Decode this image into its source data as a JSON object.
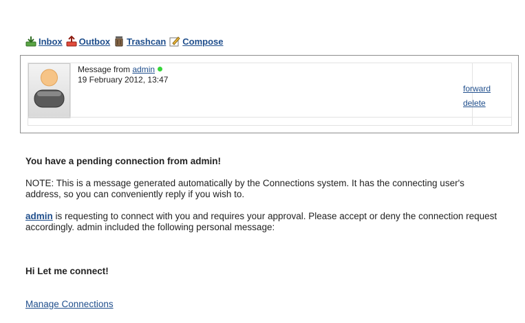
{
  "nav": {
    "items": [
      {
        "label": "Inbox",
        "icon": "inbox-icon"
      },
      {
        "label": "Outbox",
        "icon": "outbox-icon"
      },
      {
        "label": "Trashcan",
        "icon": "trashcan-icon"
      },
      {
        "label": "Compose",
        "icon": "compose-icon"
      }
    ]
  },
  "message": {
    "from_prefix": "Message from",
    "sender": "admin",
    "date": "19 February 2012, 13:47",
    "online_color": "#36d63a",
    "actions": {
      "forward": "forward",
      "delete": "delete"
    }
  },
  "body": {
    "heading": "You have a pending connection from admin!",
    "note": "NOTE: This is a message generated automatically by the Connections system. It has the connecting user's address, so you can conveniently reply if you wish to.",
    "request_link": "admin",
    "request_text": " is requesting to connect with you and requires your approval. Please accept or deny the connection request accordingly. admin included the following personal message:",
    "personal_message": "Hi Let me connect!",
    "manage_link": "Manage Connections"
  },
  "colors": {
    "link": "#1f4e8c",
    "text": "#222222",
    "border": "#8c8c8c"
  }
}
